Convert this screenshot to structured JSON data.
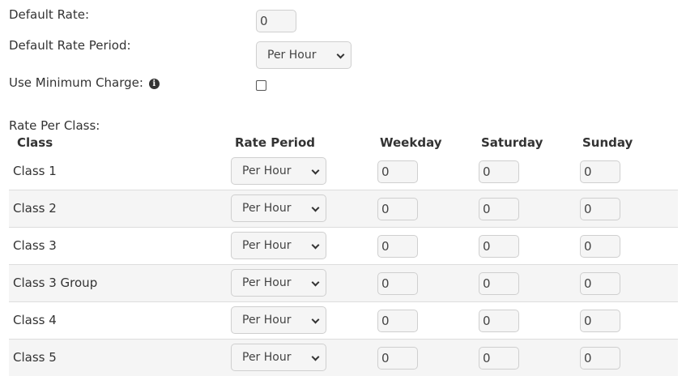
{
  "form": {
    "default_rate_label": "Default Rate:",
    "default_rate_value": "0",
    "default_rate_period_label": "Default Rate Period:",
    "default_rate_period_value": "Per Hour",
    "use_min_charge_label": "Use Minimum Charge:",
    "use_min_charge_checked": false,
    "info_icon": "info-circle-icon",
    "rate_per_class_label": "Rate Per Class:"
  },
  "table": {
    "headers": [
      "Class",
      "Rate Period",
      "Weekday",
      "Saturday",
      "Sunday"
    ],
    "rows": [
      {
        "class": "Class 1",
        "rate_period": "Per Hour",
        "weekday": "0",
        "saturday": "0",
        "sunday": "0"
      },
      {
        "class": "Class 2",
        "rate_period": "Per Hour",
        "weekday": "0",
        "saturday": "0",
        "sunday": "0"
      },
      {
        "class": "Class 3",
        "rate_period": "Per Hour",
        "weekday": "0",
        "saturday": "0",
        "sunday": "0"
      },
      {
        "class": "Class 3 Group",
        "rate_period": "Per Hour",
        "weekday": "0",
        "saturday": "0",
        "sunday": "0"
      },
      {
        "class": "Class 4",
        "rate_period": "Per Hour",
        "weekday": "0",
        "saturday": "0",
        "sunday": "0"
      },
      {
        "class": "Class 5",
        "rate_period": "Per Hour",
        "weekday": "0",
        "saturday": "0",
        "sunday": "0"
      }
    ]
  }
}
